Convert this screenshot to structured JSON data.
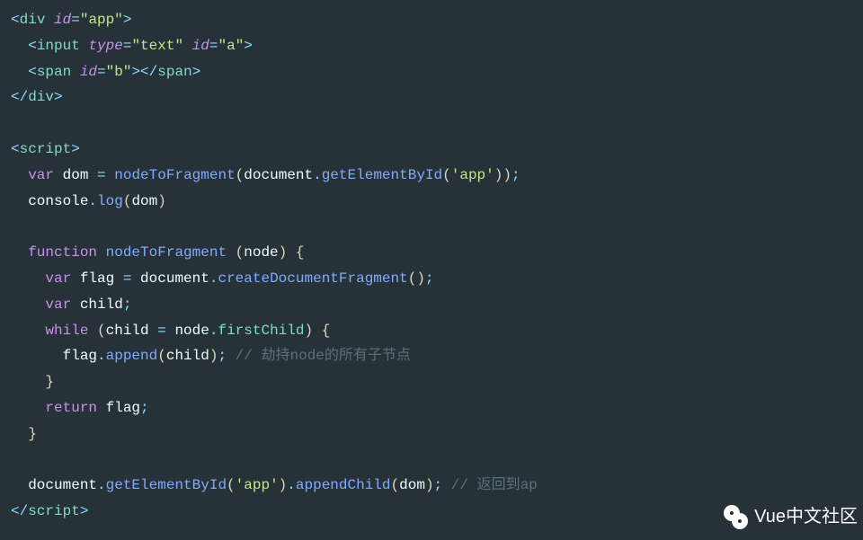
{
  "code": {
    "line1": {
      "open": "<",
      "tag": "div",
      "attr": "id",
      "eq": "=",
      "val": "\"app\"",
      "close": ">"
    },
    "line2": {
      "open": "<",
      "tag": "input",
      "attr1": "type",
      "val1": "\"text\"",
      "attr2": "id",
      "val2": "\"a\"",
      "close": ">"
    },
    "line3": {
      "open": "<",
      "tag": "span",
      "attr": "id",
      "val": "\"b\"",
      "mid": "></",
      "tag2": "span",
      "close": ">"
    },
    "line4": {
      "open": "</",
      "tag": "div",
      "close": ">"
    },
    "line6": {
      "open": "<",
      "tag": "script",
      "close": ">"
    },
    "line7": {
      "kw": "var",
      "id1": "dom",
      "eq": " = ",
      "fn": "nodeToFragment",
      "lp": "(",
      "obj": "document",
      "dot": ".",
      "meth": "getElementById",
      "lp2": "(",
      "str": "'app'",
      "rp2": ")",
      "rp": ")",
      "semi": ";"
    },
    "line8": {
      "obj": "console",
      "dot": ".",
      "meth": "log",
      "lp": "(",
      "arg": "dom",
      "rp": ")"
    },
    "line10": {
      "kw": "function",
      "fn": "nodeToFragment",
      "lp": " (",
      "param": "node",
      "rp": ") ",
      "brace": "{"
    },
    "line11": {
      "kw": "var",
      "id": "flag",
      "eq": " = ",
      "obj": "document",
      "dot": ".",
      "meth": "createDocumentFragment",
      "lp": "(",
      "rp": ")",
      "semi": ";"
    },
    "line12": {
      "kw": "var",
      "id": "child",
      "semi": ";"
    },
    "line13": {
      "kw": "while",
      "lp": " (",
      "lhs": "child",
      "eq": " = ",
      "obj": "node",
      "dot": ".",
      "prop": "firstChild",
      "rp": ") ",
      "brace": "{"
    },
    "line14": {
      "obj": "flag",
      "dot": ".",
      "meth": "append",
      "lp": "(",
      "arg": "child",
      "rp": ")",
      "semi": ";",
      "comment": " // 劫持node的所有子节点"
    },
    "line15": {
      "brace": "}"
    },
    "line16": {
      "kw": "return",
      "id": " flag",
      "semi": ";"
    },
    "line17": {
      "brace": "}"
    },
    "line19": {
      "obj": "document",
      "dot": ".",
      "meth": "getElementById",
      "lp": "(",
      "str": "'app'",
      "rp": ")",
      "dot2": ".",
      "meth2": "appendChild",
      "lp2": "(",
      "arg": "dom",
      "rp2": ")",
      "semi": ";",
      "comment": " // 返回到ap"
    },
    "line20": {
      "open": "</",
      "tag": "script",
      "close": ">"
    }
  },
  "watermark": {
    "text": "Vue中文社区"
  }
}
